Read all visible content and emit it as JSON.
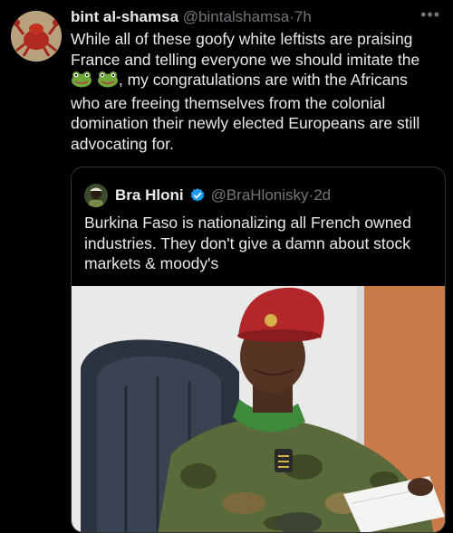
{
  "tweet": {
    "author_name": "bint al-shamsa",
    "handle": "@bintalshamsa",
    "separator": "·",
    "time": "7h",
    "text_before_emoji": "While all of these goofy white leftists are praising France and telling everyone we should imitate the",
    "emoji_names": [
      "frog-emoji",
      "frog-emoji"
    ],
    "text_after_emoji": ", my congratulations are with the Africans who are freeing themselves from the colonial domination their newly elected Europeans are still advocating for.",
    "more_label": "•••"
  },
  "quoted_tweet": {
    "author_name": "Bra Hloni",
    "handle": "@BraHlonisky",
    "separator": "·",
    "time": "2d",
    "verified": true,
    "text": "Burkina Faso is nationalizing all French owned industries. They don't give a damn about stock markets & moody's",
    "image": "photo-soldier-red-beret-reading-papers"
  },
  "colors": {
    "background": "#000000",
    "text": "#e7e9ea",
    "muted": "#71767b",
    "border": "#2f3336",
    "verified": "#1d9bf0",
    "beret": "#b3272a",
    "camo": "#5b6a3a"
  }
}
